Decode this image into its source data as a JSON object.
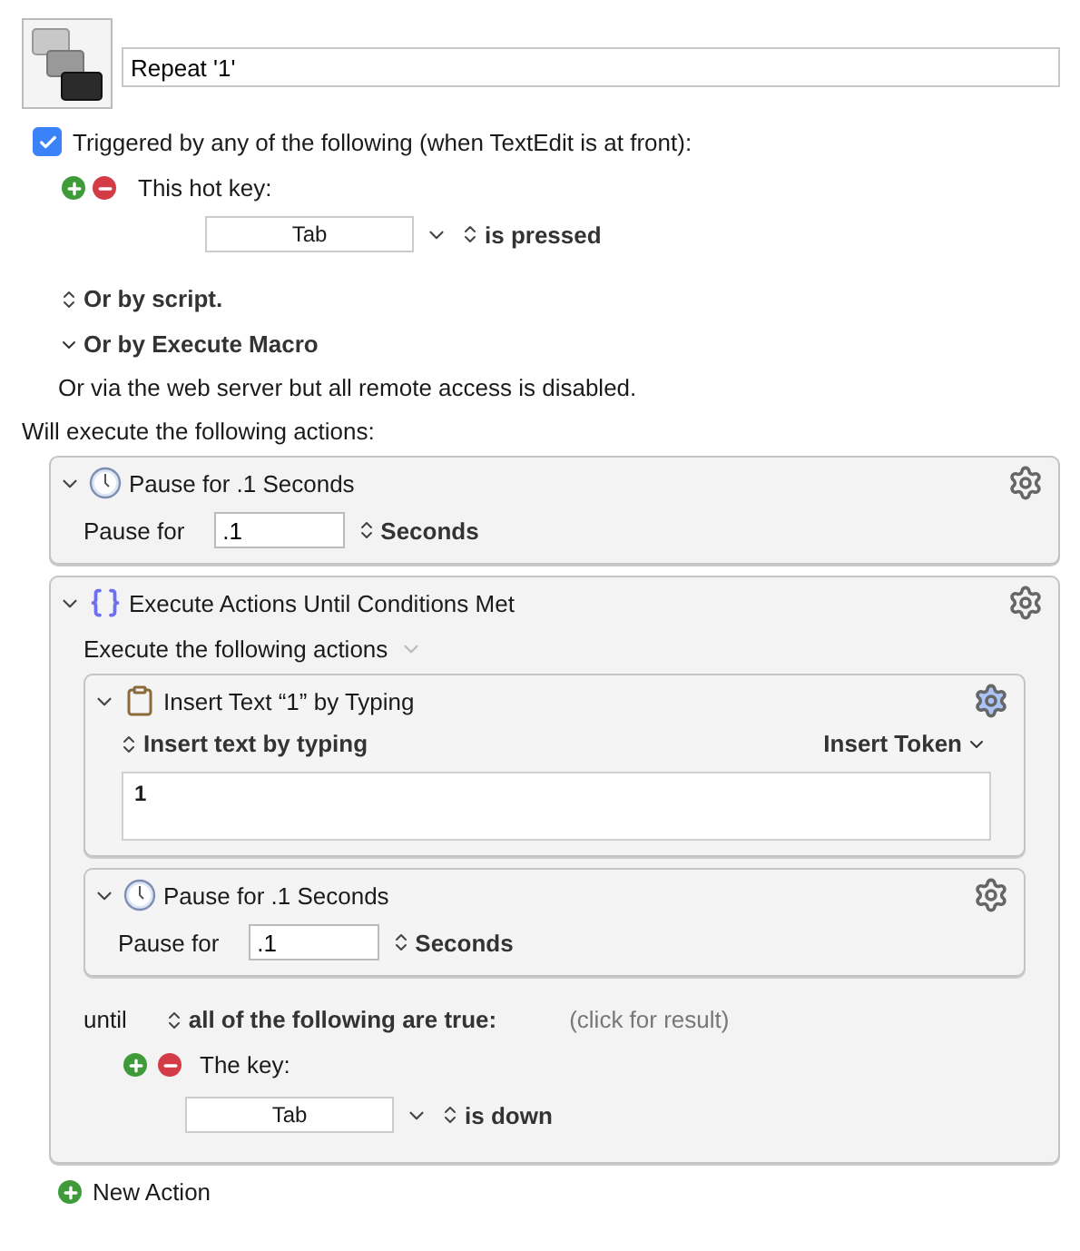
{
  "macro": {
    "name": "Repeat '1'"
  },
  "trigger": {
    "checked": true,
    "label": "Triggered by any of the following (when TextEdit is at front):",
    "hotkey_label": "This hot key:",
    "key": "Tab",
    "condition": "is pressed",
    "or_script": "Or by script.",
    "or_execute": "Or by Execute Macro",
    "web_server": "Or via the web server but all remote access is disabled."
  },
  "actions_heading": "Will execute the following actions:",
  "actions": [
    {
      "kind": "pause",
      "expanded": true,
      "title": "Pause for .1 Seconds",
      "label": "Pause for",
      "value": ".1",
      "unit": "Seconds"
    },
    {
      "kind": "until",
      "expanded": true,
      "title": "Execute Actions Until Conditions Met",
      "subheading": "Execute the following actions",
      "actions": [
        {
          "kind": "insert",
          "expanded": true,
          "title": "Insert Text “1” by Typing",
          "mode": "Insert text by typing",
          "token": "Insert Token",
          "text": "1"
        },
        {
          "kind": "pause",
          "expanded": true,
          "title": "Pause for .1 Seconds",
          "label": "Pause for",
          "value": ".1",
          "unit": "Seconds"
        }
      ],
      "until_label": "until",
      "condition": "all of the following are true:",
      "result": "(click for result)",
      "key_label": "The key:",
      "key": "Tab",
      "key_state": "is down"
    }
  ],
  "new_action": "New Action"
}
